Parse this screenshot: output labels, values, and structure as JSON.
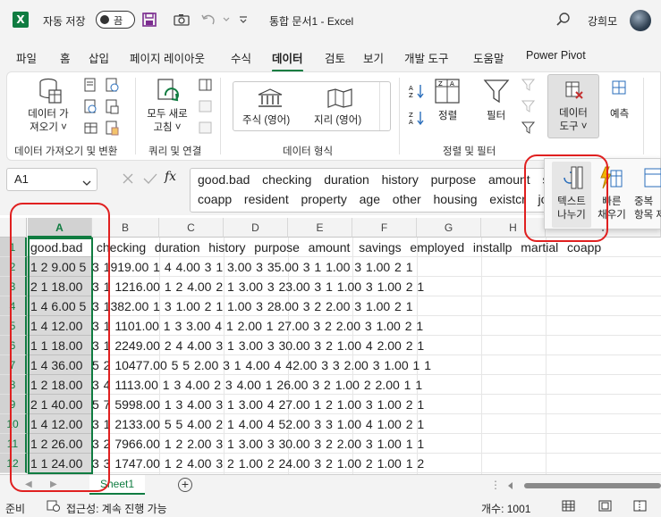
{
  "titlebar": {
    "autosave_label": "자동 저장",
    "autosave_state": "끔",
    "doc_title": "통합 문서1  -  Excel",
    "user_name": "강희모",
    "icons": [
      "excel-logo-icon",
      "save-icon",
      "camera-icon",
      "undo-icon",
      "redo-icon",
      "customize-icon",
      "search-icon"
    ]
  },
  "tabs": [
    "파일",
    "홈",
    "삽입",
    "페이지 레이아웃",
    "수식",
    "데이터",
    "검토",
    "보기",
    "개발 도구",
    "도움말",
    "Power Pivot"
  ],
  "active_tab": "데이터",
  "ribbon": {
    "get_data": "데이터 가\n져오기 ˅",
    "refresh_all": "모두 새로\n고침 ˅",
    "stock": "주식 (영어)",
    "geo": "지리 (영어)",
    "sort": "정렬",
    "filter": "필터",
    "data_tools": "데이터\n도구 ˅",
    "forecast": "예측",
    "group_get": "데이터 가져오기 및 변환",
    "group_query": "쿼리 및 연결",
    "group_types": "데이터 형식",
    "group_sort": "정렬 및 필터"
  },
  "dropdown": {
    "text_to_columns": "텍스트\n나누기",
    "flash_fill": "빠른\n채우기",
    "remove_dup": "중복\n항목 제"
  },
  "formula_bar": {
    "name_box": "A1",
    "fx": "fx",
    "formula": "good.bad  checking  duration  history  purpose  amount  savin\ncoapp  resident  property  age  other  housing  existcr  jo"
  },
  "grid": {
    "columns": [
      "A",
      "B",
      "C",
      "D",
      "E",
      "F",
      "G",
      "H",
      "I"
    ],
    "rows": [
      "1",
      "2",
      "3",
      "4",
      "5",
      "6",
      "7",
      "8",
      "9",
      "10",
      "11",
      "12"
    ],
    "col_a": [
      "good.bad",
      "1 2 9.00 5",
      "2 1 18.00",
      "1 4 6.00 5",
      "1 4 12.00",
      "1 1 18.00",
      "1 4 36.00",
      "1 2 18.00",
      "2 1 40.00",
      "1 4 12.00",
      "1 2 26.00",
      "1 1 24.00"
    ],
    "rest": [
      " checking  duration  history  purpose  amount  savings  employed  installp  martial  coapp",
      "3 1919.00 1 4 4.00 3 1 3.00 3 35.00 3 1 1.00 3 1.00 2 1",
      "3 1 1216.00 1 2 4.00 2 1 3.00 3 23.00 3 1 1.00 3 1.00 2 1",
      "3 1382.00 1 3 1.00 2 1 1.00 3 28.00 3 2 2.00 3 1.00 2 1",
      "3 1 1101.00 1 3 3.00 4 1 2.00 1 27.00 3 2 2.00 3 1.00 2 1",
      "3 1 2249.00 2 4 4.00 3 1 3.00 3 30.00 3 2 1.00 4 2.00 2 1",
      "5 2 10477.00 5 5 2.00 3 1 4.00 4 42.00 3 3 2.00 3 1.00 1 1",
      "3 4 1113.00 1 3 4.00 2 3 4.00 1 26.00 3 2 1.00 2 2.00 1 1",
      "5 7 5998.00 1 3 4.00 3 1 3.00 4 27.00 1 2 1.00 3 1.00 2 1",
      "3 1 2133.00 5 5 4.00 2 1 4.00 4 52.00 3 3 1.00 4 1.00 2 1",
      "3 2 7966.00 1 2 2.00 3 1 3.00 3 30.00 3 2 2.00 3 1.00 1 1",
      "3 3 1747.00 1 2 4.00 3 2 1.00 2 24.00 3 2 1.00 2 1.00 1 2"
    ]
  },
  "sheet_tab": "Sheet1",
  "status": {
    "ready": "준비",
    "accessibility": "접근성: 계속 진행 가능",
    "count": "개수: 1001"
  },
  "colors": {
    "accent": "#107c41",
    "annotation": "#e02020"
  }
}
